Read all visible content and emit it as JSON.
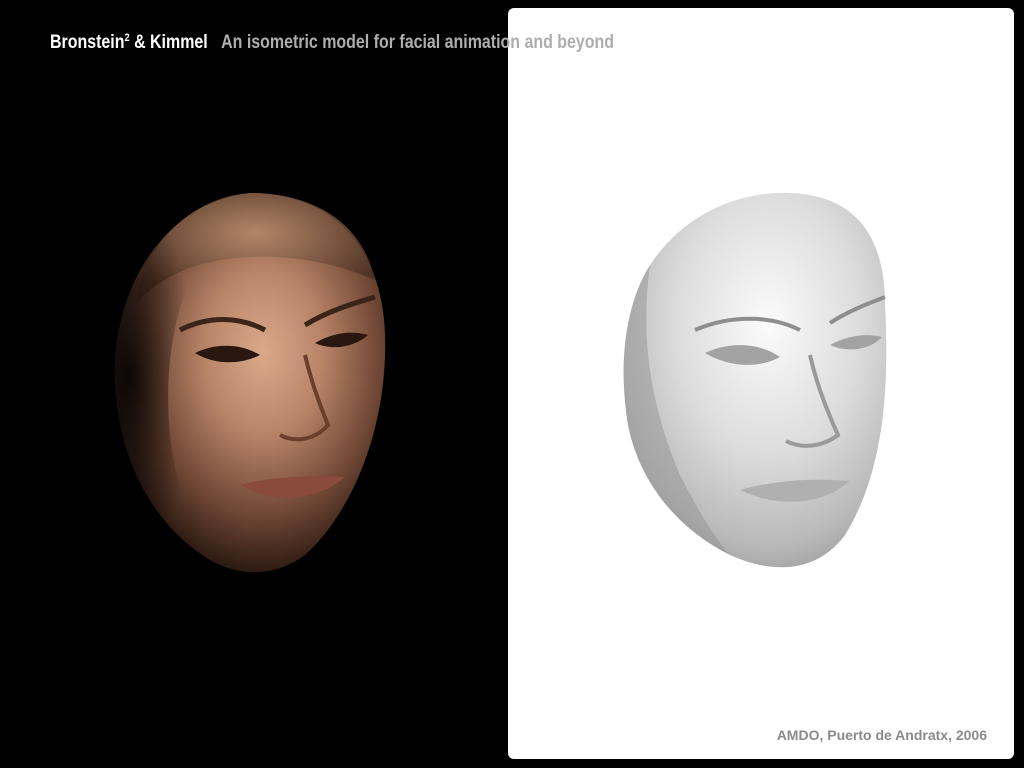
{
  "header": {
    "authors_prefix": "Bronstein",
    "authors_sup": "2",
    "authors_suffix": " & Kimmel",
    "title": "An isometric model for facial animation and beyond"
  },
  "footer": {
    "conference": "AMDO, Puerto de Andratx, 2006"
  },
  "colors": {
    "background": "#000000",
    "panel": "#ffffff",
    "author_text": "#ffffff",
    "title_text": "#aeaeae",
    "footer_text": "#8a8a8a"
  }
}
